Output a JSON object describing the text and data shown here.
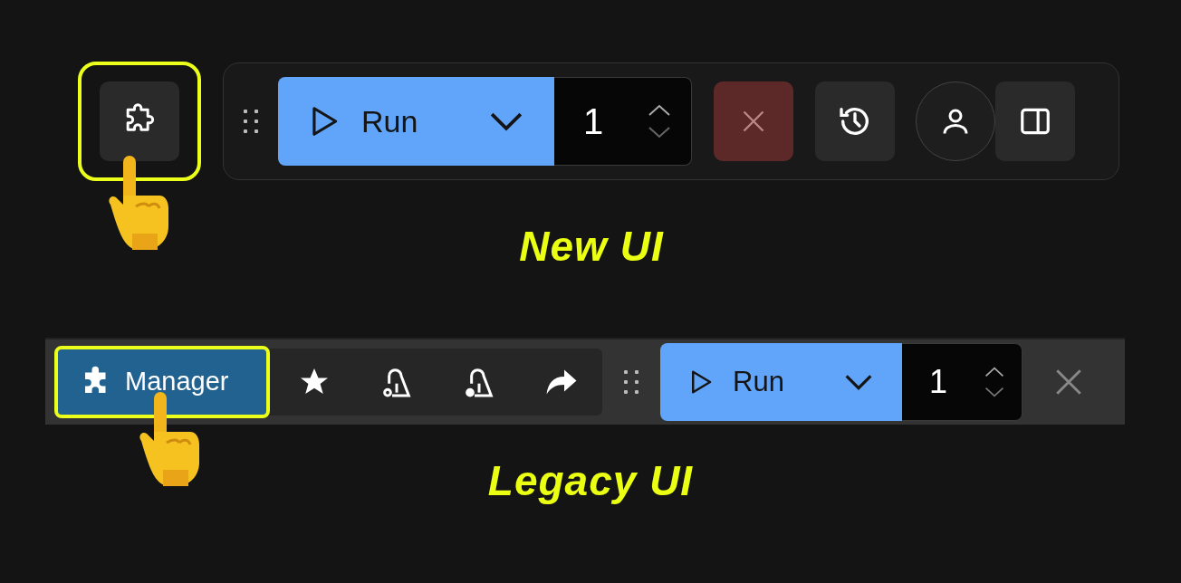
{
  "new_ui": {
    "extensions_button": {
      "highlighted": true
    },
    "toolbar": {
      "run_label": "Run",
      "count": "1"
    },
    "caption": "New UI"
  },
  "legacy_ui": {
    "manager_button": {
      "label": "Manager",
      "highlighted": true
    },
    "toolbar": {
      "run_label": "Run",
      "count": "1"
    },
    "caption": "Legacy UI"
  }
}
